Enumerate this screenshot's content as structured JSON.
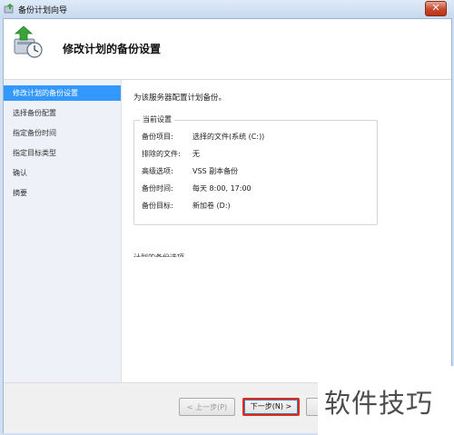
{
  "window": {
    "title": "备份计划向导"
  },
  "header": {
    "title": "修改计划的备份设置"
  },
  "sidebar": {
    "items": [
      {
        "label": "修改计划的备份设置",
        "active": true
      },
      {
        "label": "选择备份配置",
        "active": false
      },
      {
        "label": "指定备份时间",
        "active": false
      },
      {
        "label": "指定目标类型",
        "active": false
      },
      {
        "label": "确认",
        "active": false
      },
      {
        "label": "摘要",
        "active": false
      }
    ]
  },
  "content": {
    "intro": "为该服务器配置计划备份。",
    "current_settings": {
      "title": "当前设置",
      "rows": [
        {
          "key": "备份项目:",
          "value": "选择的文件(系统 (C:))"
        },
        {
          "key": "排除的文件:",
          "value": "无"
        },
        {
          "key": "高级选项:",
          "value": "VSS 副本备份"
        },
        {
          "key": "备份时间:",
          "value": "每天 8:00, 17:00"
        },
        {
          "key": "备份目标:",
          "value": "新加卷 (D:)"
        }
      ]
    },
    "cut_text": "计划的备份选项"
  },
  "footer": {
    "prev_label": "< 上一步(P)",
    "next_label": "下一步(N) >"
  },
  "watermark": {
    "text": "软件技巧"
  },
  "colors": {
    "accent": "#3399ff",
    "highlight_border": "#e2271d"
  }
}
